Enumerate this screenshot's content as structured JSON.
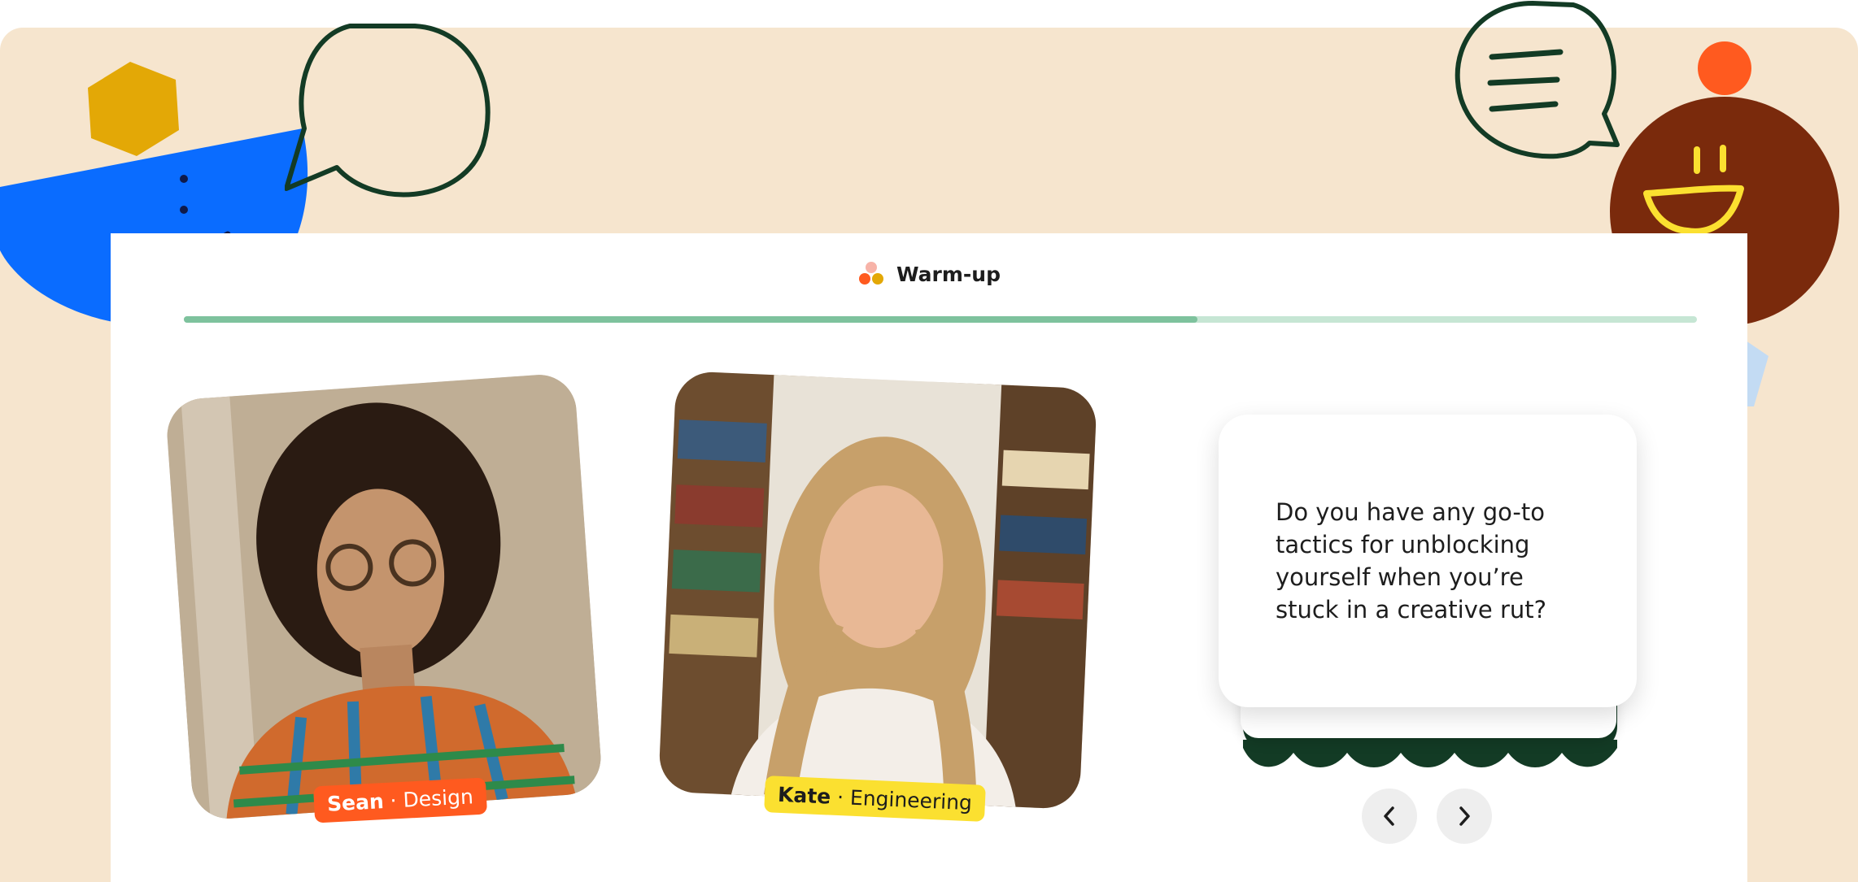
{
  "header": {
    "title": "Warm-up",
    "icon": "three-dots-icon"
  },
  "progress": {
    "value": 0.67
  },
  "participants": [
    {
      "name": "Sean",
      "separator": "·",
      "role": "Design",
      "tag_color": "#ff5a1f"
    },
    {
      "name": "Kate",
      "separator": "·",
      "role": "Engineering",
      "tag_color": "#fbe030"
    }
  ],
  "question_card": {
    "text": "Do you have any go-to tactics for unblocking yourself when you’re stuck in a creative rut?"
  },
  "navigation": {
    "prev_icon": "chevron-left-icon",
    "next_icon": "chevron-right-icon"
  },
  "colors": {
    "background": "#f6e5ce",
    "progress_fill": "#7ec29d",
    "progress_track": "#c6e6d4",
    "card_stack": "#133b25",
    "blue_character": "#0a6cff",
    "brown_character": "#7a2a0c",
    "orange_dot": "#ff5a1f",
    "yellow_hexagon": "#e3a806",
    "light_blue_pentagon": "#c3dbf3"
  }
}
